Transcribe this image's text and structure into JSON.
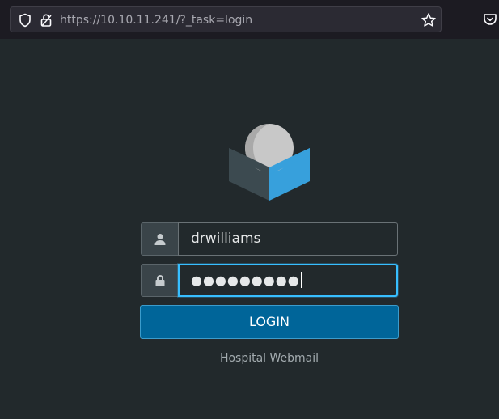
{
  "browser": {
    "url_host": "https://10.10.11.241",
    "url_path": "/?_task=login",
    "icons": [
      "shield-icon",
      "lock-icon",
      "star-icon",
      "pocket-icon"
    ]
  },
  "login": {
    "username_value": "drwilliams",
    "password_masked": "●●●●●●●●●",
    "username_icon": "user-icon",
    "password_icon": "lock-icon",
    "submit_label": "LOGIN",
    "footer_label": "Hospital Webmail"
  },
  "colors": {
    "background": "#22292c",
    "button": "#006599",
    "focus_border": "#37beff",
    "logo_blue": "#37a0dc"
  }
}
